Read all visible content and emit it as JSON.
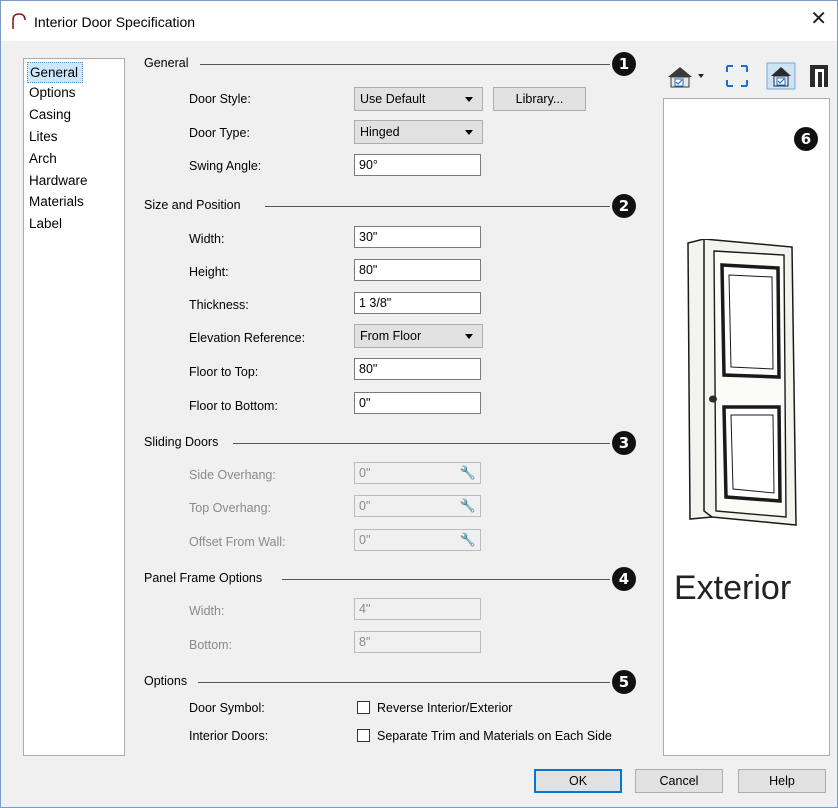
{
  "window": {
    "title": "Interior Door Specification"
  },
  "nav": {
    "items": [
      "General",
      "Options",
      "Casing",
      "Lites",
      "Arch",
      "Hardware",
      "Materials",
      "Label"
    ]
  },
  "general": {
    "title": "General",
    "badge": "1",
    "door_style_label": "Door Style:",
    "door_style_value": "Use Default",
    "library_button": "Library...",
    "door_type_label": "Door Type:",
    "door_type_value": "Hinged",
    "swing_angle_label": "Swing Angle:",
    "swing_angle_value": "90°"
  },
  "size": {
    "title": "Size and Position",
    "badge": "2",
    "width_label": "Width:",
    "width_value": "30\"",
    "height_label": "Height:",
    "height_value": "80\"",
    "thickness_label": "Thickness:",
    "thickness_value": "1 3/8\"",
    "elev_label": "Elevation Reference:",
    "elev_value": "From Floor",
    "floor_top_label": "Floor to Top:",
    "floor_top_value": "80\"",
    "floor_bottom_label": "Floor to Bottom:",
    "floor_bottom_value": "0\""
  },
  "sliding": {
    "title": "Sliding Doors",
    "badge": "3",
    "side_label": "Side Overhang:",
    "side_value": "0\"",
    "top_label": "Top Overhang:",
    "top_value": "0\"",
    "offset_label": "Offset From Wall:",
    "offset_value": "0\""
  },
  "panel": {
    "title": "Panel Frame Options",
    "badge": "4",
    "width_label": "Width:",
    "width_value": "4\"",
    "bottom_label": "Bottom:",
    "bottom_value": "8\""
  },
  "options": {
    "title": "Options",
    "badge": "5",
    "door_symbol_label": "Door Symbol:",
    "reverse_label": "Reverse Interior/Exterior",
    "interior_doors_label": "Interior Doors:",
    "separate_label": "Separate Trim and Materials on Each Side"
  },
  "preview": {
    "badge": "6",
    "text": "Exterior"
  },
  "footer": {
    "ok": "OK",
    "cancel": "Cancel",
    "help": "Help"
  }
}
